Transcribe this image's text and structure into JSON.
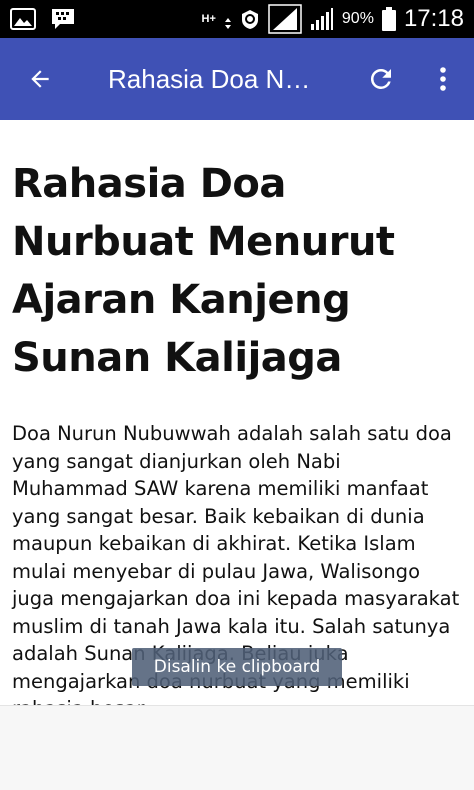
{
  "status_bar": {
    "network_type": "H+",
    "battery_percent": "90%",
    "time": "17:18",
    "icons": [
      "image-notification-icon",
      "bbm-icon",
      "data-arrows-icon",
      "sync-icon",
      "signal-icon",
      "battery-icon"
    ]
  },
  "app_bar": {
    "title": "Rahasia Doa Nurbuat Menurut Ajaran Kanjeng Sunan Kalijaga",
    "color": "#3F51B5",
    "icons": [
      "back-arrow-icon",
      "refresh-icon",
      "more-vert-icon"
    ]
  },
  "article": {
    "title": "Rahasia Doa Nurbuat Menurut Ajaran Kanjeng Sunan Kalijaga",
    "body": "Doa Nurun Nubuwwah adalah salah satu doa yang sangat dianjurkan oleh Nabi Muhammad SAW karena memiliki manfaat yang sangat besar. Baik kebaikan di dunia maupun kebaikan di akhirat. Ketika Islam mulai menyebar di pulau Jawa, Walisongo juga mengajarkan doa ini kepada masyarakat muslim di tanah Jawa kala itu. Salah satunya adalah Sunan Kalijaga. Beliau juka mengajarkan doa nurbuat yang memiliki rahasia besar"
  },
  "toast": {
    "message": "Disalin ke clipboard"
  }
}
